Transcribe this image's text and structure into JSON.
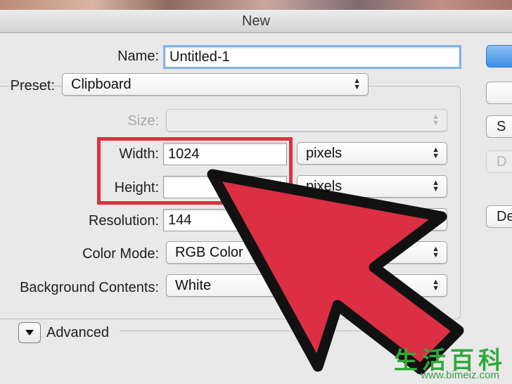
{
  "window": {
    "title": "New"
  },
  "form": {
    "name_label": "Name:",
    "name_value": "Untitled-1",
    "preset_label": "Preset:",
    "preset_value": "Clipboard",
    "size_label": "Size:",
    "size_value": "",
    "width_label": "Width:",
    "width_value": "1024",
    "width_unit": "pixels",
    "height_label": "Height:",
    "height_value": "",
    "height_unit": "pixels",
    "resolution_label": "Resolution:",
    "resolution_value": "144",
    "color_mode_label": "Color Mode:",
    "color_mode_value": "RGB Color",
    "background_label": "Background Contents:",
    "background_value": "White",
    "advanced_label": "Advanced"
  },
  "side_buttons": {
    "save_preset_label": "S",
    "delete_preset_label": "D",
    "device_central_label": "De"
  },
  "watermark": {
    "characters": "生活百科",
    "url": "www.bimeiz.com"
  },
  "colors": {
    "highlight": "#e0303f",
    "arrow": "#dc2f44",
    "focus": "#80b3ea",
    "watermark": "#2faa3a"
  }
}
